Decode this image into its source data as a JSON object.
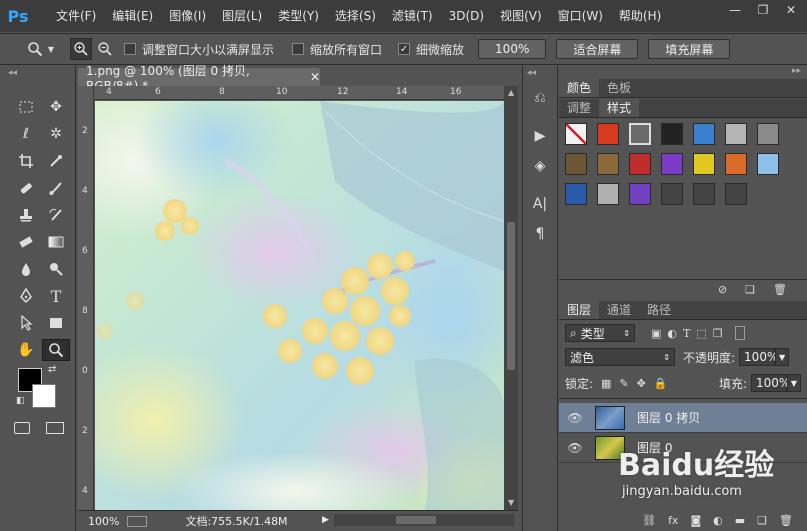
{
  "app": {
    "logo": "Ps"
  },
  "menu": [
    "文件(F)",
    "编辑(E)",
    "图像(I)",
    "图层(L)",
    "类型(Y)",
    "选择(S)",
    "滤镜(T)",
    "3D(D)",
    "视图(V)",
    "窗口(W)",
    "帮助(H)"
  ],
  "window_controls": {
    "minimize": "—",
    "restore": "❐",
    "close": "✕"
  },
  "options": {
    "resize_windows_label": "调整窗口大小以满屏显示",
    "resize_windows_checked": false,
    "zoom_all_label": "缩放所有窗口",
    "zoom_all_checked": false,
    "scrubby_zoom_label": "细微缩放",
    "scrubby_zoom_checked": true,
    "percent_button": "100%",
    "fit_screen_button": "适合屏幕",
    "fill_screen_button": "填充屏幕"
  },
  "document": {
    "tab_title": "1.png @ 100% (图层 0 拷贝, RGB/8#) *",
    "ruler_marks": [
      "4",
      "6",
      "8",
      "10",
      "12",
      "14",
      "16"
    ],
    "ruler_marks_v": [
      "2",
      "4",
      "6",
      "8",
      "0",
      "2",
      "4"
    ],
    "zoom": "100%",
    "doc_size": "文档:755.5K/1.48M"
  },
  "color_panel": {
    "tabs": [
      "颜色",
      "色板"
    ]
  },
  "styles_panel": {
    "tabs": [
      "调整",
      "样式"
    ],
    "active_tab": "样式",
    "swatches": [
      "#f2f2f2",
      "#d83a20",
      "#6b6b6b",
      "#222222",
      "#3b7fd1",
      "#b5b5b5",
      "#8a8a8a",
      "#6e5533",
      "#8a6a3a",
      "#c02c2c",
      "#7a3cc4",
      "#e0c820",
      "#d86a2a",
      "#8ec0e8",
      "#2a5aa8",
      "#b0b0b0",
      "#7040c0",
      "#444444",
      "#444444",
      "#444444"
    ]
  },
  "layers_panel": {
    "tabs": [
      "图层",
      "通道",
      "路径"
    ],
    "filter_kind": "类型",
    "blend_mode": "滤色",
    "opacity_label": "不透明度:",
    "opacity_value": "100%",
    "lock_label": "锁定:",
    "fill_label": "填充:",
    "fill_value": "100%",
    "layers": [
      {
        "name": "图层 0 拷贝",
        "selected": true
      },
      {
        "name": "图层 0",
        "selected": false
      }
    ]
  },
  "watermark": {
    "brand": "Baidu经验",
    "url": "jingyan.baidu.com"
  }
}
